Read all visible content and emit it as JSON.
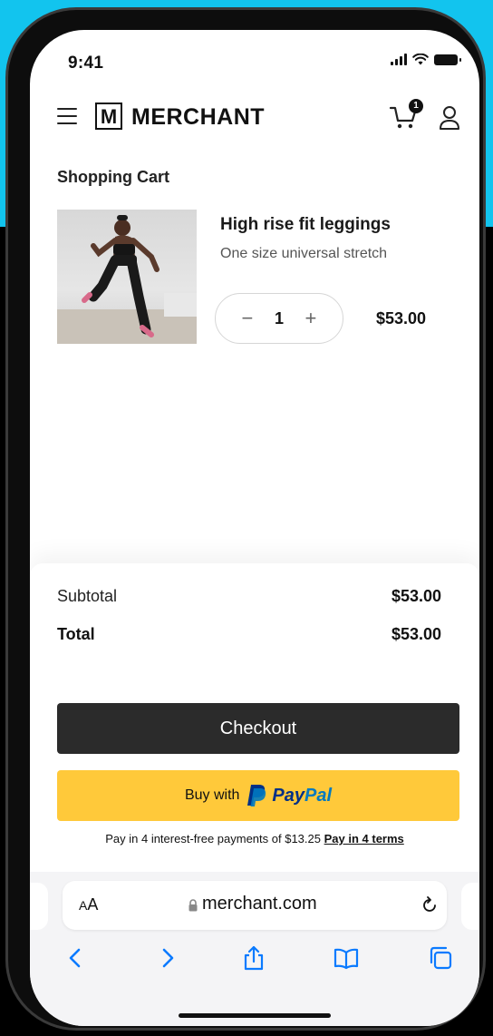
{
  "status_bar": {
    "time": "9:41"
  },
  "header": {
    "logo_mark": "M",
    "logo_text": "MERCHANT",
    "cart_count": "1"
  },
  "cart": {
    "title": "Shopping Cart",
    "item": {
      "name": "High rise fit leggings",
      "description": "One size universal stretch",
      "quantity": "1",
      "decrement": "−",
      "increment": "+",
      "price": "$53.00"
    }
  },
  "summary": {
    "subtotal_label": "Subtotal",
    "subtotal_value": "$53.00",
    "total_label": "Total",
    "total_value": "$53.00"
  },
  "actions": {
    "checkout_label": "Checkout",
    "paypal_prefix": "Buy with",
    "paypal_word_1": "Pay",
    "paypal_word_2": "Pal",
    "pay_in_4_text": "Pay in 4 interest-free payments of $13.25",
    "pay_in_4_link": "Pay in 4 terms"
  },
  "browser": {
    "aa_small": "A",
    "aa_large": "A",
    "url": "merchant.com"
  },
  "colors": {
    "background_accent": "#12c4ee",
    "checkout_button": "#2b2b2b",
    "paypal_button": "#ffc93a",
    "paypal_dark": "#003087",
    "paypal_light": "#0079c1",
    "safari_blue": "#0a7aff"
  },
  "icons": [
    "menu-icon",
    "cart-icon",
    "user-icon",
    "lock-icon",
    "reload-icon",
    "back-icon",
    "forward-icon",
    "share-icon",
    "bookmarks-icon",
    "tabs-icon"
  ]
}
